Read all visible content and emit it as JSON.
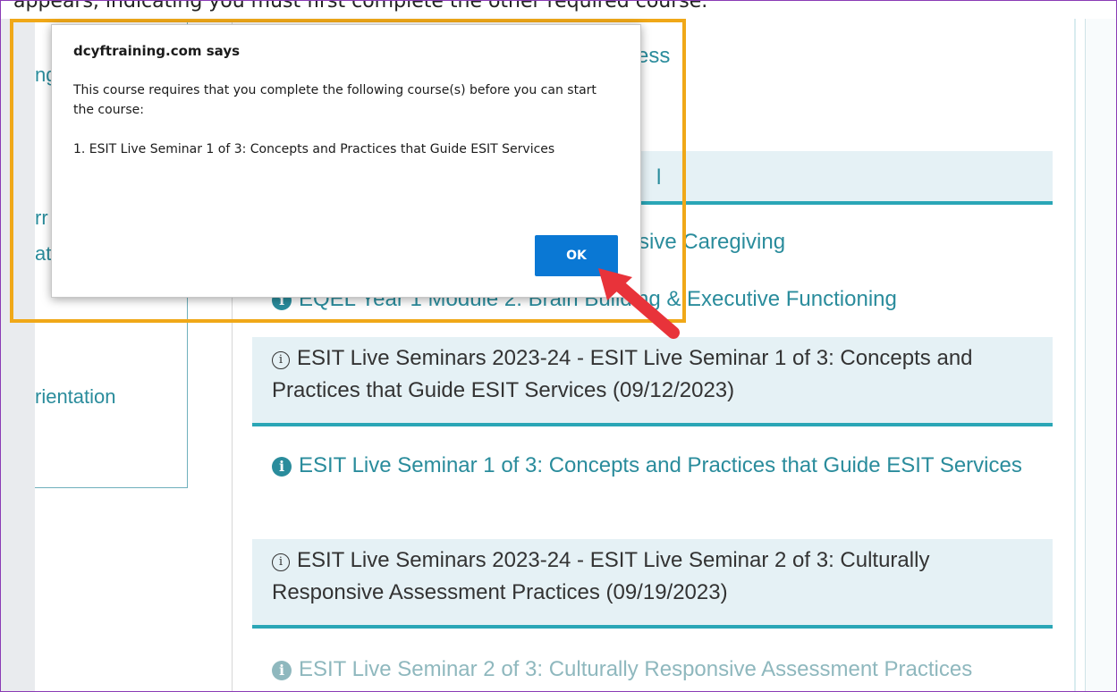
{
  "top_strip": {
    "text": "appears, indicating you must first complete the other required course."
  },
  "left_panel": {
    "frag1": "ng",
    "frag2": "rr",
    "frag3": "at",
    "frag4": "rientation"
  },
  "partials": {
    "p1": "cess",
    "p2": "l",
    "p3": "sive Caregiving",
    "p4": "Building & Executive Functioning"
  },
  "rows": [
    {
      "type": "link",
      "text": "EQEL Year 1 Module 2: Brain Building & Executive Functioning"
    },
    {
      "type": "header",
      "text": "ESIT Live Seminars 2023-24 - ESIT Live Seminar 1 of 3: Concepts and Practices that Guide ESIT Services (09/12/2023)"
    },
    {
      "type": "link",
      "text": "ESIT Live Seminar 1 of 3: Concepts and Practices that Guide ESIT Services"
    },
    {
      "type": "header",
      "text": "ESIT Live Seminars 2023-24 - ESIT Live Seminar 2 of 3: Culturally Responsive Assessment Practices (09/19/2023)"
    },
    {
      "type": "link",
      "text": "ESIT Live Seminar 2 of 3: Culturally Responsive Assessment Practices"
    }
  ],
  "dialog": {
    "title": "dcyftraining.com says",
    "line1": "This course requires that you complete the following course(s) before you can start the course:",
    "line2": "1. ESIT Live Seminar 1 of 3: Concepts and Practices that Guide ESIT Services",
    "ok_label": "OK"
  },
  "colors": {
    "accent": "#2aa6b6",
    "link": "#2a8c9c",
    "highlight": "#f0a818",
    "button": "#0a78d4",
    "arrow": "#e8333a"
  }
}
